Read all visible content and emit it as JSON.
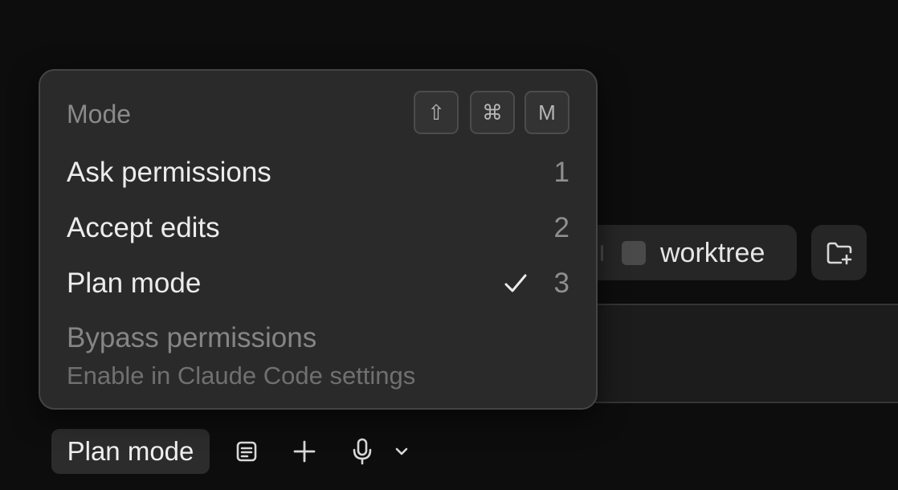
{
  "composer": {
    "worktree_label": "worktree",
    "worktree_checked": false,
    "icons": {
      "folder_add": "folder-plus-icon",
      "notes": "notes-icon",
      "add": "plus-icon",
      "mic": "microphone-icon",
      "dropdown": "chevron-down-icon"
    },
    "mode_button_label": "Plan mode"
  },
  "mode_menu": {
    "heading": "Mode",
    "shortcut_keys": [
      "⇧",
      "⌘",
      "M"
    ],
    "items": [
      {
        "label": "Ask permissions",
        "shortcut": "1",
        "selected": false
      },
      {
        "label": "Accept edits",
        "shortcut": "2",
        "selected": false
      },
      {
        "label": "Plan mode",
        "shortcut": "3",
        "selected": true
      }
    ],
    "disabled_item": {
      "label": "Bypass permissions",
      "hint": "Enable in Claude Code settings"
    }
  }
}
